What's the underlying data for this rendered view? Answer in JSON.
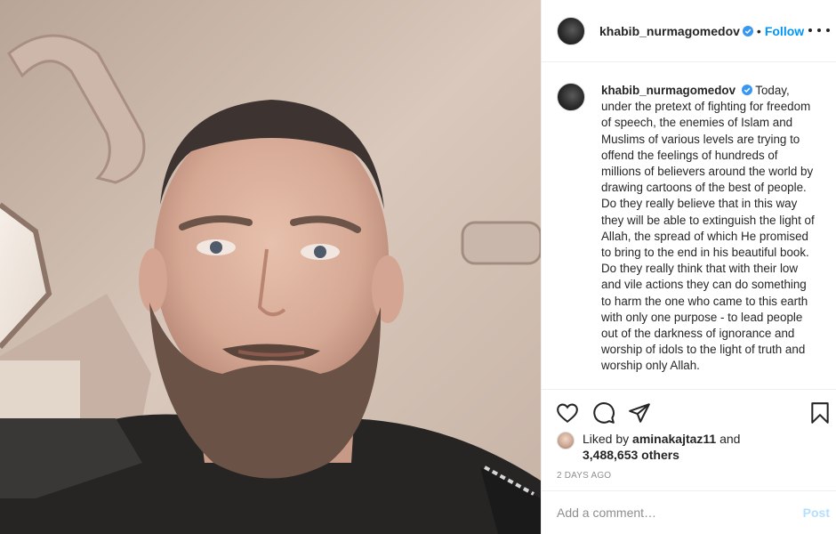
{
  "post": {
    "author": "khabib_nurmagomedov",
    "follow_label": "Follow",
    "separator": "•",
    "photo_alt": "khabib_nurmagomedov post photo",
    "caption_text": "Today, under the pretext of fighting for freedom of speech, the enemies of Islam and Muslims of various levels are trying to offend the feelings of hundreds of millions of believers around the world by drawing cartoons of the best of people. Do they really believe that in this way they will be able to extinguish the light of Allah, the spread of which He promised to bring to the end in his beautiful book. Do they really think that with their low and vile actions they can do something to harm the one who came to this earth with only one purpose - to lead people out of the darkness of ignorance and worship of idols to the light of truth and worship only Allah.",
    "likes_prefix": "Liked by",
    "liked_by": "aminakajtaz11",
    "likes_and": "and",
    "likes_others": "3,488,653 others",
    "timestamp": "2 DAYS AGO"
  },
  "comment": {
    "placeholder": "Add a comment…",
    "post_label": "Post"
  },
  "icons": {
    "verified": "verified-badge-icon",
    "like": "heart-icon",
    "comment": "comment-icon",
    "share": "paper-plane-icon",
    "save": "bookmark-icon",
    "more": "more-options-icon"
  },
  "colors": {
    "accent": "#0095f6",
    "post_disabled": "#b2dffc",
    "muted": "#8e8e8e",
    "text": "#262626",
    "divider": "#efefef"
  }
}
